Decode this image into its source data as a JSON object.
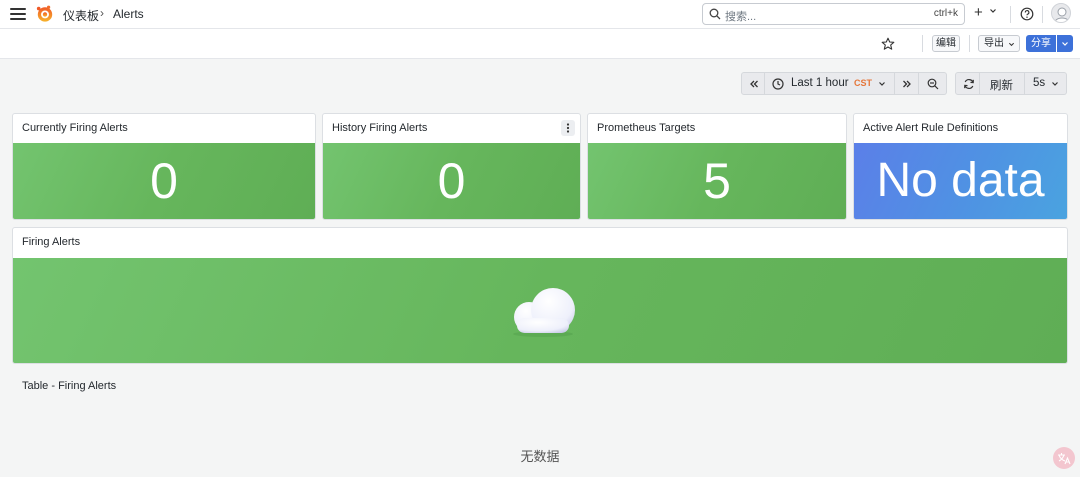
{
  "header": {
    "breadcrumb": [
      "仪表板",
      "Alerts"
    ],
    "breadcrumb_separator": "›",
    "search_placeholder": "搜索...",
    "search_shortcut": "ctrl+k",
    "new_label": "+"
  },
  "toolbar": {
    "edit_label": "编辑",
    "export_label": "导出",
    "share_label": "分享"
  },
  "time_controls": {
    "range_label": "Last 1 hour",
    "timezone": "CST",
    "refresh_label": "刷新",
    "interval": "5s"
  },
  "panels": {
    "currently_firing": {
      "title": "Currently Firing Alerts",
      "value": "0",
      "color": "#6bbd62"
    },
    "history_firing": {
      "title": "History Firing Alerts",
      "value": "0",
      "color": "#6bbd62"
    },
    "prometheus_targets": {
      "title": "Prometheus Targets",
      "value": "5",
      "color": "#6bbd62"
    },
    "active_rules": {
      "title": "Active Alert Rule Definitions",
      "value": "No data",
      "color": "#5090e4"
    },
    "firing_alerts": {
      "title": "Firing Alerts",
      "icon": "cloud-icon"
    },
    "table_firing": {
      "title": "Table - Firing Alerts",
      "empty_text": "无数据"
    }
  },
  "colors": {
    "accent": "#3d71d9",
    "ok": "#6bbd62",
    "no_data": "#5090e4",
    "timezone": "#e5763a"
  }
}
